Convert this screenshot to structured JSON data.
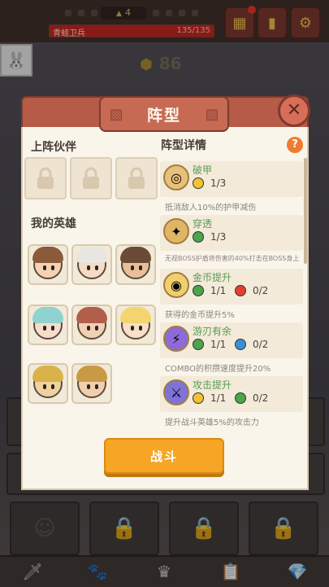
{
  "topbar": {
    "stage": "4",
    "boss_name": "青蛙卫兵",
    "boss_hp": "135/135"
  },
  "coins": "86",
  "modal": {
    "title": "阵型",
    "left_sections": {
      "partners_title": "上阵伙伴",
      "heroes_title": "我的英雄"
    },
    "detail_title": "阵型详情",
    "help": "?",
    "details": [
      {
        "name": "破甲",
        "req": [
          {
            "icon": "yellow",
            "count": "1/3"
          }
        ],
        "desc": "抵消敌人10%的护甲减伤"
      },
      {
        "name": "穿透",
        "req": [
          {
            "icon": "green",
            "count": "1/3"
          }
        ],
        "desc": "无视BOSS护盾将伤害的40%打击在BOSS身上"
      },
      {
        "name": "金币提升",
        "req": [
          {
            "icon": "green",
            "count": "1/1"
          },
          {
            "icon": "red",
            "count": "0/2"
          }
        ],
        "desc": "获得的金币提升5%"
      },
      {
        "name": "游刃有余",
        "req": [
          {
            "icon": "green",
            "count": "1/1"
          },
          {
            "icon": "blue",
            "count": "0/2"
          }
        ],
        "desc": "COMBO的积攒速度提升20%"
      },
      {
        "name": "攻击提升",
        "req": [
          {
            "icon": "yellow",
            "count": "1/1"
          },
          {
            "icon": "green",
            "count": "0/2"
          }
        ],
        "desc": "提升战斗英雄5%的攻击力"
      }
    ],
    "fight_label": "战斗"
  },
  "colors": {
    "accent": "#f6a524",
    "header": "#b55b47",
    "green_text": "#5a9a55",
    "req_yellow": "#f2c233",
    "req_green": "#4aa64a",
    "req_red": "#e5402f",
    "req_blue": "#3a8fd8"
  }
}
